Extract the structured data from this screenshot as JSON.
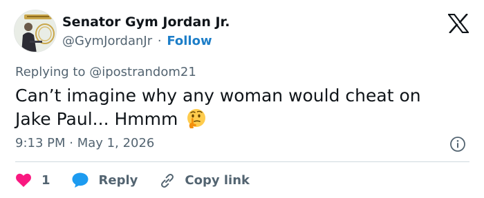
{
  "author": {
    "name": "Senator Gym Jordan Jr.",
    "handle": "@GymJordanJr",
    "separator": "·",
    "follow_label": "Follow"
  },
  "reply_context": {
    "prefix": "Replying to",
    "mention": "@ipostrandom21"
  },
  "tweet": {
    "text": "Can’t imagine why any woman would cheat on Jake Paul... Hmmm",
    "emoji": "thinking-face"
  },
  "meta": {
    "time": "9:13 PM",
    "separator": "·",
    "date": "May 1, 2026"
  },
  "actions": {
    "like_count": "1",
    "reply_label": "Reply",
    "copy_label": "Copy link"
  },
  "icons": {
    "platform_logo": "x-logo-icon",
    "info": "info-icon",
    "like": "heart-icon",
    "reply": "speech-bubble-icon",
    "copy": "link-icon"
  },
  "colors": {
    "follow": "#1d7ec8",
    "heart": "#f91880",
    "reply_bubble": "#1d9bf0",
    "muted": "#536471",
    "text": "#0f1419"
  }
}
